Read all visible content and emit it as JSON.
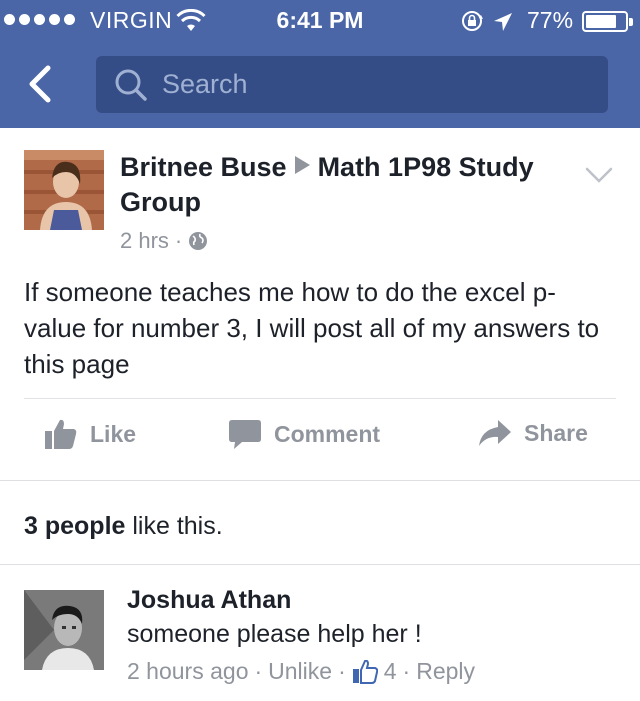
{
  "status_bar": {
    "carrier": "VIRGIN",
    "time": "6:41 PM",
    "battery_percent": "77%",
    "battery_level": 0.77
  },
  "nav": {
    "search_placeholder": "Search"
  },
  "post": {
    "author": "Britnee Buse",
    "group": "Math 1P98 Study Group",
    "time": "2 hrs",
    "separator": "·",
    "text": "If someone teaches me how to do the excel p-value for number 3, I will post all of my answers to this page"
  },
  "actions": {
    "like": "Like",
    "comment": "Comment",
    "share": "Share"
  },
  "likes_summary": {
    "count_text": "3 people",
    "suffix": " like this."
  },
  "comment": {
    "author": "Joshua Athan",
    "text": "someone please help her !",
    "time": "2 hours ago",
    "dot": "·",
    "unlike": "Unlike",
    "like_count": "4",
    "reply": "Reply"
  },
  "colors": {
    "brand_blue": "#4a66a6",
    "search_bg": "#344d86",
    "muted_text": "#90949c",
    "like_blue": "#4267b2"
  },
  "icons": [
    "signal-dots-icon",
    "wifi-icon",
    "rotation-lock-icon",
    "location-arrow-icon",
    "battery-icon",
    "back-chevron-icon",
    "search-icon",
    "chevron-down-icon",
    "globe-icon",
    "like-thumb-icon",
    "comment-bubble-icon",
    "share-arrow-icon",
    "blue-like-badge-icon"
  ]
}
